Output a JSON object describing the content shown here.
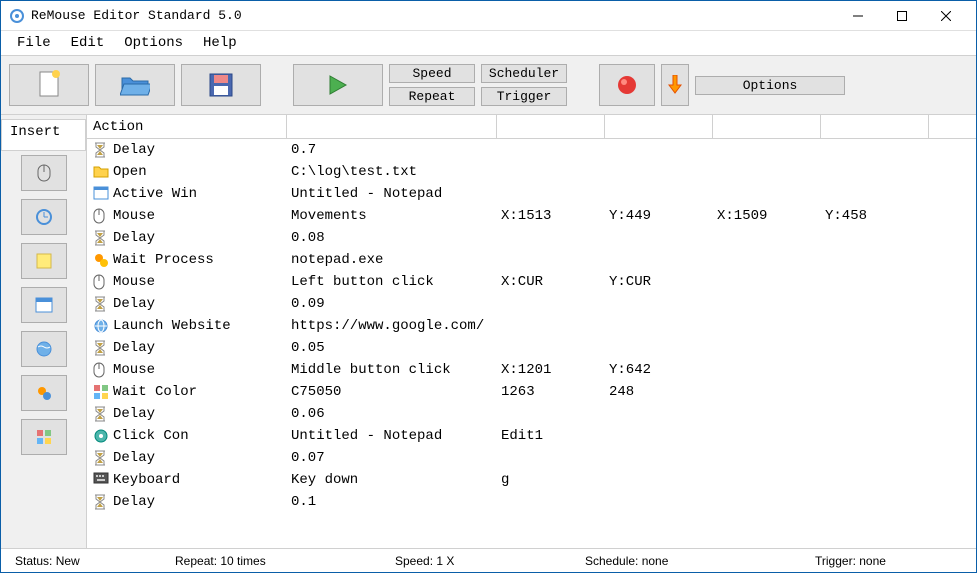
{
  "window": {
    "title": "ReMouse Editor Standard 5.0"
  },
  "menubar": [
    "File",
    "Edit",
    "Options",
    "Help"
  ],
  "toolbar": {
    "speed": "Speed",
    "repeat": "Repeat",
    "scheduler": "Scheduler",
    "trigger": "Trigger",
    "options": "Options"
  },
  "insert_label": "Insert",
  "grid": {
    "header": "Action",
    "rows": [
      {
        "icon": "hourglass",
        "label": "Delay",
        "c1": "0.7"
      },
      {
        "icon": "folder",
        "label": "Open",
        "c1": "C:\\log\\test.txt"
      },
      {
        "icon": "window",
        "label": "Active Win",
        "c1": "Untitled - Notepad"
      },
      {
        "icon": "mouse",
        "label": "Mouse",
        "c1": "Movements",
        "c2": "X:1513",
        "c3": "Y:449",
        "c4": "X:1509",
        "c5": "Y:458"
      },
      {
        "icon": "hourglass",
        "label": "Delay",
        "c1": "0.08"
      },
      {
        "icon": "gears",
        "label": "Wait Process",
        "c1": "notepad.exe"
      },
      {
        "icon": "mouse",
        "label": "Mouse",
        "c1": "Left button click",
        "c2": "X:CUR",
        "c3": "Y:CUR"
      },
      {
        "icon": "hourglass",
        "label": "Delay",
        "c1": "0.09"
      },
      {
        "icon": "globe",
        "label": "Launch Website",
        "c1": "https://www.google.com/"
      },
      {
        "icon": "hourglass",
        "label": "Delay",
        "c1": "0.05"
      },
      {
        "icon": "mouse",
        "label": "Mouse",
        "c1": "Middle button click",
        "c2": "X:1201",
        "c3": "Y:642"
      },
      {
        "icon": "palette",
        "label": "Wait Color",
        "c1": "C75050",
        "c2": "1263",
        "c3": "248"
      },
      {
        "icon": "hourglass",
        "label": "Delay",
        "c1": "0.06"
      },
      {
        "icon": "target",
        "label": "Click Con",
        "c1": "Untitled - Notepad",
        "c2": "Edit1"
      },
      {
        "icon": "hourglass",
        "label": "Delay",
        "c1": "0.07"
      },
      {
        "icon": "keyboard",
        "label": "Keyboard",
        "c1": "Key down",
        "c2": "g"
      },
      {
        "icon": "hourglass",
        "label": "Delay",
        "c1": "0.1"
      }
    ]
  },
  "statusbar": {
    "status": "Status: New",
    "repeat": "Repeat: 10 times",
    "speed": "Speed: 1 X",
    "schedule": "Schedule: none",
    "trigger": "Trigger: none"
  }
}
